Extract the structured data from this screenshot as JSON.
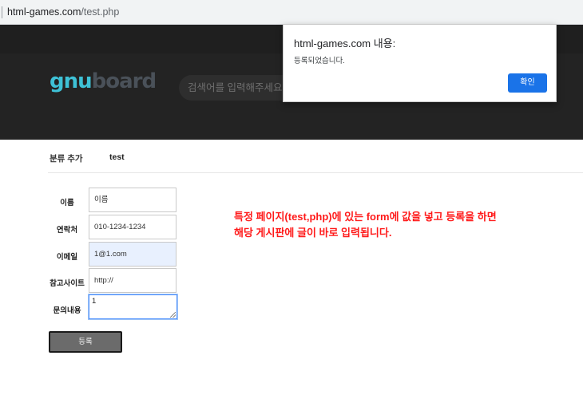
{
  "browser": {
    "url_host": "html-games.com",
    "url_path": "/test.php"
  },
  "header": {
    "logo_part1": "gnu",
    "logo_part2": "board",
    "search_placeholder": "검색어를 입력해주세요"
  },
  "dialog": {
    "title": "html-games.com 내용:",
    "message": "등록되었습니다.",
    "ok_label": "확인"
  },
  "breadcrumb": {
    "title": "분류 추가",
    "sub": "test"
  },
  "form": {
    "fields": [
      {
        "label": "이름",
        "value": "이름"
      },
      {
        "label": "연락처",
        "value": "010-1234-1234"
      },
      {
        "label": "이메일",
        "value": "1@1.com"
      },
      {
        "label": "참고사이트",
        "value": "http://"
      },
      {
        "label": "문의내용",
        "value": "1"
      }
    ],
    "submit_label": "등록"
  },
  "note": {
    "line1": "특정 페이지(test,php)에 있는 form에 값을 넣고 등록을 하면",
    "line2": "해당 게시판에 글이 바로 입력됩니다."
  },
  "colors": {
    "accent_blue": "#1a73e8",
    "logo_cyan": "#3ec1d6",
    "note_red": "#ff1a1a"
  }
}
